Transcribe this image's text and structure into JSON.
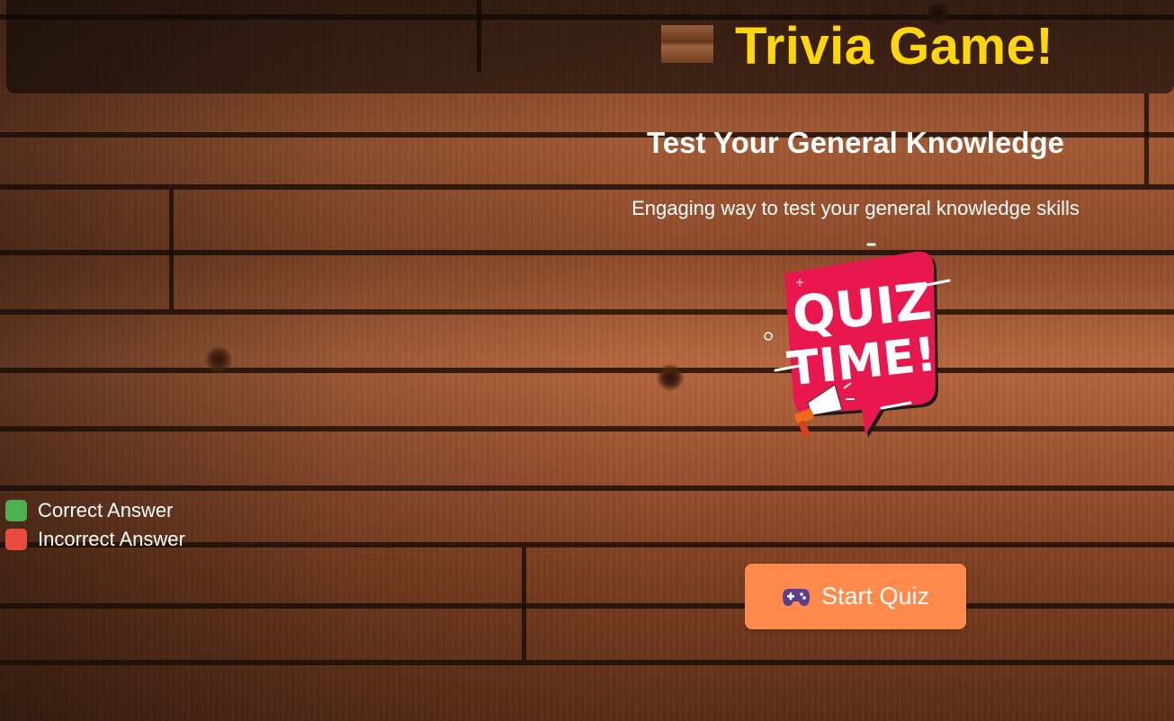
{
  "header": {
    "title": "Trivia Game!",
    "title_color": "#ffd60a"
  },
  "hero": {
    "subtitle": "Test Your General Knowledge",
    "tagline": "Engaging way to test your general knowledge skills",
    "image_text_line1": "QUIZ",
    "image_text_line2": "TIME!"
  },
  "legend": {
    "items": [
      {
        "label": "Correct Answer",
        "color": "#4caf50"
      },
      {
        "label": "Incorrect Answer",
        "color": "#e74c3c"
      }
    ]
  },
  "start_button": {
    "icon": "game-controller-icon",
    "label": "Start Quiz",
    "color": "#ff8a4c"
  }
}
